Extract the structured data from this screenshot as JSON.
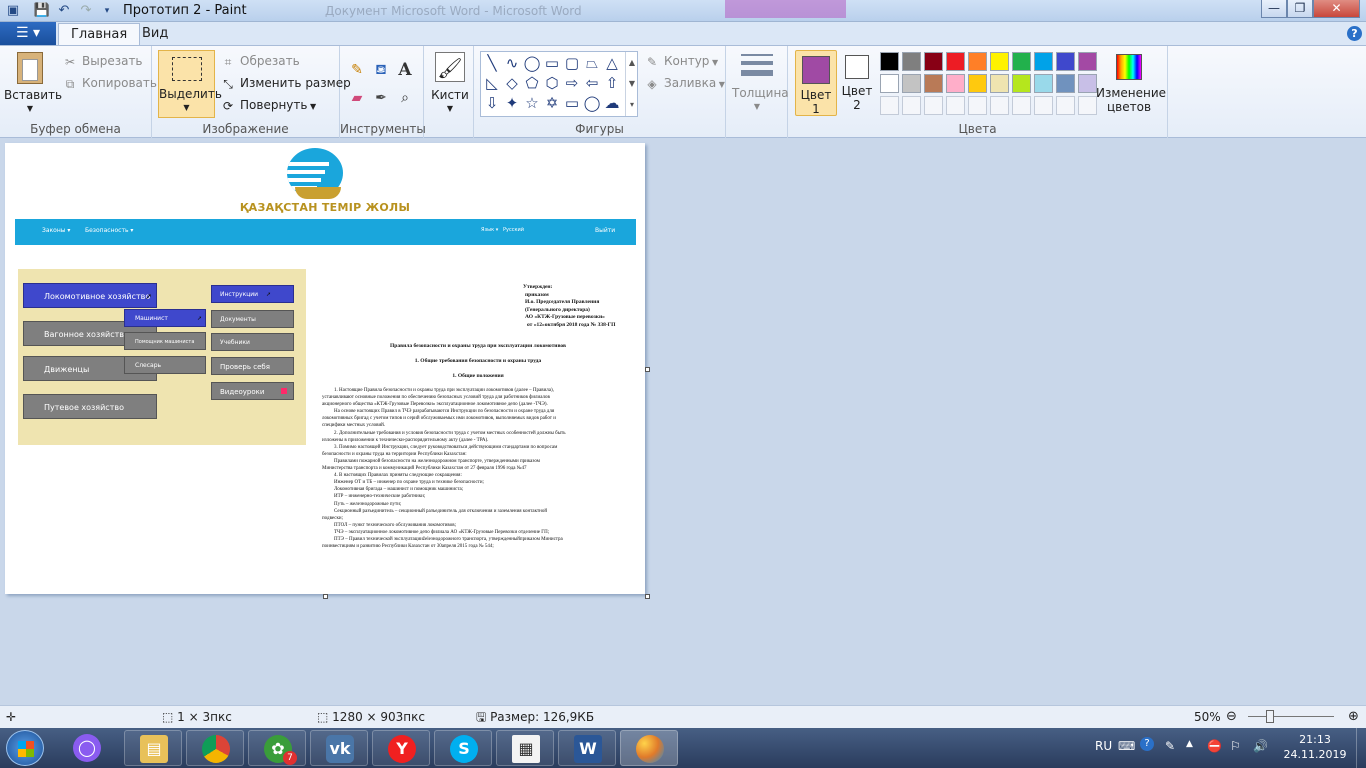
{
  "window": {
    "title": "Прототип 2 - Paint",
    "ghost_title": "Документ Microsoft Word - Microsoft Word",
    "controls": {
      "minimize": "—",
      "maximize": "❐",
      "close": "✕"
    }
  },
  "tabs": {
    "file": "☰ ▾",
    "home": "Главная",
    "view": "Вид",
    "help": "?"
  },
  "ribbon": {
    "clipboard": {
      "label": "Буфер обмена",
      "paste": "Вставить",
      "cut": "Вырезать",
      "copy": "Копировать"
    },
    "image": {
      "label": "Изображение",
      "select": "Выделить",
      "crop": "Обрезать",
      "resize": "Изменить размер",
      "rotate": "Повернуть"
    },
    "tools": {
      "label": "Инструменты",
      "text_tool": "A"
    },
    "brushes": {
      "label": "Кисти"
    },
    "shapes": {
      "label": "Фигуры",
      "outline": "Контур",
      "fill": "Заливка"
    },
    "size": {
      "label": "Толщина"
    },
    "color1": {
      "label": "Цвет 1",
      "value": "#a04aa4"
    },
    "color2": {
      "label": "Цвет 2",
      "value": "#ffffff"
    },
    "colors": {
      "label": "Цвета",
      "edit": "Изменение цветов"
    },
    "palette_row1": [
      "#000000",
      "#7f7f7f",
      "#880015",
      "#ed1c24",
      "#ff7f27",
      "#fff200",
      "#22b14c",
      "#00a2e8",
      "#3f48cc",
      "#a349a4"
    ],
    "palette_row2": [
      "#ffffff",
      "#c3c3c3",
      "#b97a57",
      "#ffaec9",
      "#ffc90e",
      "#efe4b0",
      "#b5e61d",
      "#99d9ea",
      "#7092be",
      "#c8bfe7"
    ]
  },
  "doc": {
    "logo_text": "ҚАЗАҚСТАН ТЕМІР ЖОЛЫ",
    "nav": {
      "laws": "Законы",
      "safety": "Безопасность",
      "lang_label": "Язык",
      "lang_value": "Русский",
      "logout": "Выйти"
    },
    "left_menu": [
      "Локомотивное хозяйство",
      "Вагонное хозяйство",
      "Движенцы",
      "Путевое хозяйство"
    ],
    "submenu": [
      "Машинист",
      "Помощник машиниста",
      "Слесарь"
    ],
    "right_menu": [
      "Инструкции",
      "Документы",
      "Учебники",
      "Проверь себя",
      "Видеоуроки"
    ],
    "approved": [
      "Утвержден:",
      "приказом",
      "И.о. Председателя Правления",
      "(Генерального директора)",
      "АО «КТЖ-Грузовые перевозки»",
      "от «12»октября 2018 года № 338-ГП"
    ],
    "title": "Правила безопасности и охраны труда при эксплуатации локомотивов",
    "section1": "1.      Общие требования безопасности и охраны труда",
    "section2": "1.          Общие положения",
    "body": [
      "1. Настоящие Правила безопасности и охраны труда при эксплуатации локомотивов (далее – Правила),",
      "устанавливают основные положения по обеспечению безопасных условий труда для работников филиалов",
      "акционерного общества «КТЖ-Грузовые Перевозки» эксплуатационное локомотивное депо (далее -ТЧЭ).",
      "На основе настоящих Правил в ТЧЭ разрабатываются Инструкции по безопасности и охране труда для",
      "локомотивных бригад с учетом типов и серий обслуживаемых ими локомотивов, выполняемых видов работ и",
      "специфики местных условий.",
      "2. Дополнительные требования и условия безопасности труда с учетом местных особенностей должны быть",
      "изложены в приложении к технически-распорядительному акту (далее - ТРА).",
      "3. Помимо настоящей Инструкции, следует руководствоваться действующими стандартами по вопросам",
      "безопасности и охраны труда на территории Республики Казахстан:",
      "Правилами пожарной безопасности на железнодорожном транспорте, утвержденными приказом",
      "Министерства транспорта и коммуникаций Республики Казахстан от 27 февраля 1996 года №47",
      "4. В настоящих Правилах приняты следующие сокращения:",
      "Инженер ОТ и ТБ – инженер по охране труда и технике безопасности;",
      "Локомотивная бригада – машинист и помощник машиниста;",
      "ИТР – инженерно-технические работники;",
      "Путь – железнодорожные пути;",
      "Секционный разъединитель – секционный разъединитель для отключения и заземления контактной",
      "подвески;",
      "ПТОЛ – пункт технического обслуживания локомотивов;",
      "ТЧЭ – эксплуатационное локомотивное депо филиала АО «КТЖ-Грузовые Перевозки отделение ГП;",
      "ПТЭ – Правил технической эксплуатацииželезнодорожного транспорта, утвержденныйприказом Министра",
      "поинвестициям и развитию Республики Казахстан от 30апреля 2015 года № 544;"
    ]
  },
  "status": {
    "cursor": "",
    "selection": "1 × 3пкс",
    "size": "1280 × 903пкс",
    "filesize": "Размер: 126,9КБ",
    "zoom": "50%"
  },
  "taskbar": {
    "lang": "RU",
    "time": "21:13",
    "date": "24.11.2019",
    "badge": "7"
  }
}
